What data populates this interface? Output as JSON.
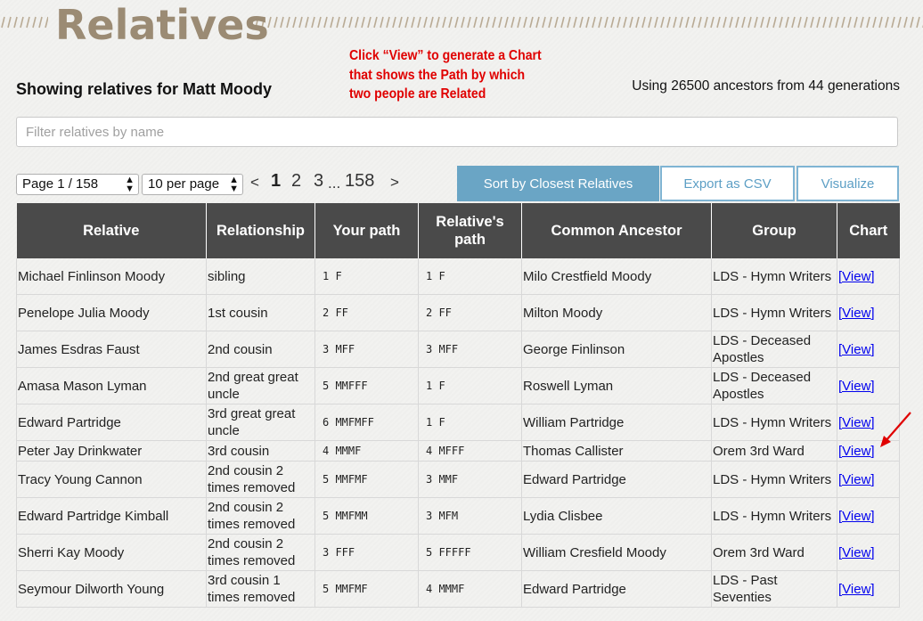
{
  "header": {
    "title": "Relatives"
  },
  "annotation": {
    "lines": [
      "Click “View” to generate a Chart",
      "that shows the Path by which",
      "two people are Related"
    ],
    "color": "#e00000"
  },
  "showing_text": "Showing relatives for Matt Moody",
  "using_text": "Using 26500 ancestors from 44 generations",
  "filter": {
    "placeholder": "Filter relatives by name",
    "value": ""
  },
  "controls": {
    "page_select": "Page 1 / 158",
    "per_page_select": "10 per page",
    "pager": {
      "prev": "<",
      "pages": [
        "1",
        "2",
        "3"
      ],
      "ellipsis": "...",
      "last": "158",
      "next": ">"
    },
    "sort_button": "Sort by Closest Relatives",
    "export_button": "Export as CSV",
    "visualize_button": "Visualize"
  },
  "colors": {
    "accent": "#6aa5c5",
    "header_bg": "#4a4a4a",
    "title": "#9b8b74",
    "link": "#0000ee"
  },
  "table": {
    "columns": [
      "Relative",
      "Relationship",
      "Your path",
      "Relative's path",
      "Common Ancestor",
      "Group",
      "Chart"
    ],
    "rows": [
      {
        "relative": "Michael Finlinson Moody",
        "relationship": "sibling",
        "your_path": "1 F",
        "relative_path": "1 F",
        "ancestor": "Milo Crestfield Moody",
        "group": "LDS - Hymn Writers",
        "chart": "[View]"
      },
      {
        "relative": "Penelope Julia Moody",
        "relationship": "1st cousin",
        "your_path": "2 FF",
        "relative_path": "2 FF",
        "ancestor": "Milton Moody",
        "group": "LDS - Hymn Writers",
        "chart": "[View]"
      },
      {
        "relative": "James Esdras Faust",
        "relationship": "2nd cousin",
        "your_path": "3 MFF",
        "relative_path": "3 MFF",
        "ancestor": "George Finlinson",
        "group": "LDS - Deceased Apostles",
        "chart": "[View]"
      },
      {
        "relative": "Amasa Mason Lyman",
        "relationship": "2nd great great uncle",
        "your_path": "5 MMFFF",
        "relative_path": "1 F",
        "ancestor": "Roswell Lyman",
        "group": "LDS - Deceased Apostles",
        "chart": "[View]"
      },
      {
        "relative": "Edward Partridge",
        "relationship": "3rd great great uncle",
        "your_path": "6 MMFMFF",
        "relative_path": "1 F",
        "ancestor": "William Partridge",
        "group": "LDS - Hymn Writers",
        "chart": "[View]"
      },
      {
        "relative": "Peter Jay Drinkwater",
        "relationship": "3rd cousin",
        "your_path": "4 MMMF",
        "relative_path": "4 MFFF",
        "ancestor": "Thomas Callister",
        "group": "Orem 3rd Ward",
        "chart": "[View]"
      },
      {
        "relative": "Tracy Young Cannon",
        "relationship": "2nd cousin 2 times removed",
        "your_path": "5 MMFMF",
        "relative_path": "3 MMF",
        "ancestor": "Edward Partridge",
        "group": "LDS - Hymn Writers",
        "chart": "[View]"
      },
      {
        "relative": "Edward Partridge Kimball",
        "relationship": "2nd cousin 2 times removed",
        "your_path": "5 MMFMM",
        "relative_path": "3 MFM",
        "ancestor": "Lydia Clisbee",
        "group": "LDS - Hymn Writers",
        "chart": "[View]"
      },
      {
        "relative": "Sherri Kay Moody",
        "relationship": "2nd cousin 2 times removed",
        "your_path": "3 FFF",
        "relative_path": "5 FFFFF",
        "ancestor": "William Cresfield Moody",
        "group": "Orem 3rd Ward",
        "chart": "[View]"
      },
      {
        "relative": "Seymour Dilworth Young",
        "relationship": "3rd cousin 1 times removed",
        "your_path": "5 MMFMF",
        "relative_path": "4 MMMF",
        "ancestor": "Edward Partridge",
        "group": "LDS - Past Seventies",
        "chart": "[View]"
      }
    ]
  }
}
